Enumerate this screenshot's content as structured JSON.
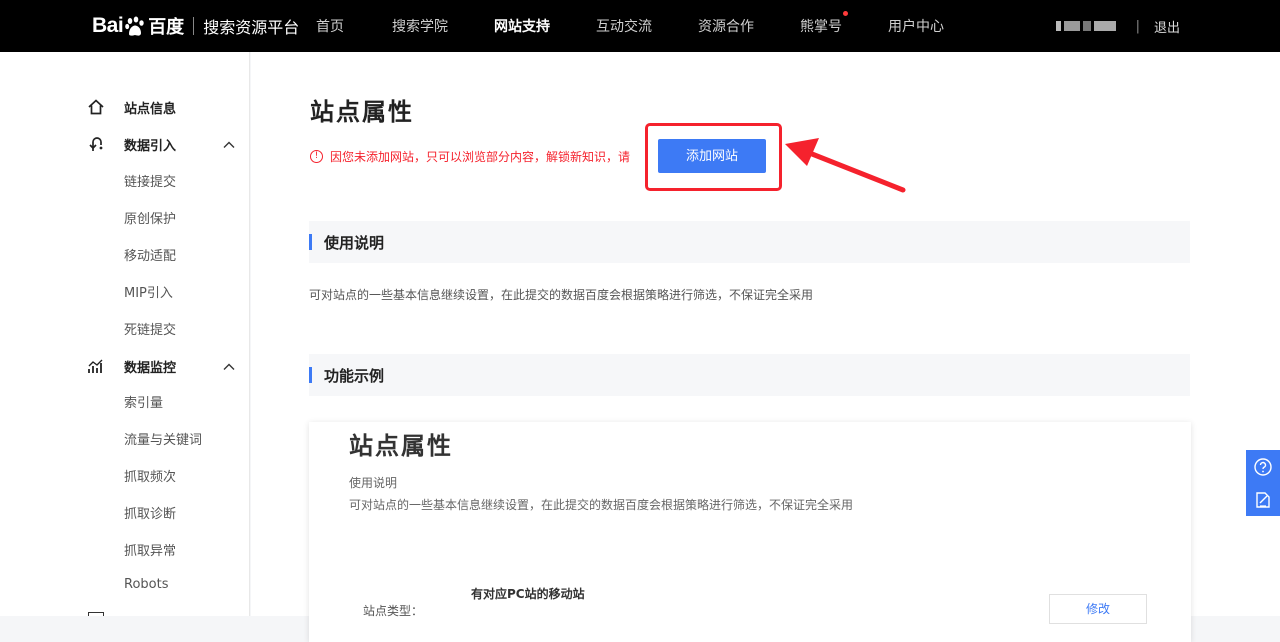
{
  "header": {
    "logo_text_bai": "Bai",
    "logo_text_baidu": "百度",
    "platform_name": "搜索资源平台",
    "nav": [
      {
        "label": "首页"
      },
      {
        "label": "搜索学院"
      },
      {
        "label": "网站支持",
        "active": true
      },
      {
        "label": "互动交流"
      },
      {
        "label": "资源合作"
      },
      {
        "label": "熊掌号",
        "has_dot": true
      },
      {
        "label": "用户中心"
      }
    ],
    "separator": "|",
    "logout_label": "退出"
  },
  "sidebar": {
    "groups": [
      {
        "label": "站点信息",
        "icon": "home-icon"
      },
      {
        "label": "数据引入",
        "icon": "data-import-icon",
        "expanded": true,
        "items": [
          "链接提交",
          "原创保护",
          "移动适配",
          "MIP引入",
          "死链提交"
        ]
      },
      {
        "label": "数据监控",
        "icon": "data-monitor-icon",
        "expanded": true,
        "items": [
          "索引量",
          "流量与关键词",
          "抓取频次",
          "抓取诊断",
          "抓取异常",
          "Robots"
        ]
      }
    ]
  },
  "main": {
    "title": "站点属性",
    "warning_text": "因您未添加网站，只可以浏览部分内容，解锁新知识，请",
    "add_site_button": "添加网站",
    "section_usage": "使用说明",
    "usage_desc": "可对站点的一些基本信息继续设置，在此提交的数据百度会根据策略进行筛选，不保证完全采用",
    "section_example": "功能示例",
    "example": {
      "title": "站点属性",
      "subtitle": "使用说明",
      "desc": "可对站点的一些基本信息继续设置，在此提交的数据百度会根据策略进行筛选，不保证完全采用",
      "option_label": "有对应PC站的移动站",
      "field_label": "站点类型：",
      "edit_button": "修改"
    }
  },
  "colors": {
    "accent": "#3d7af5",
    "warning": "#f5222d",
    "topbar": "#000000"
  }
}
